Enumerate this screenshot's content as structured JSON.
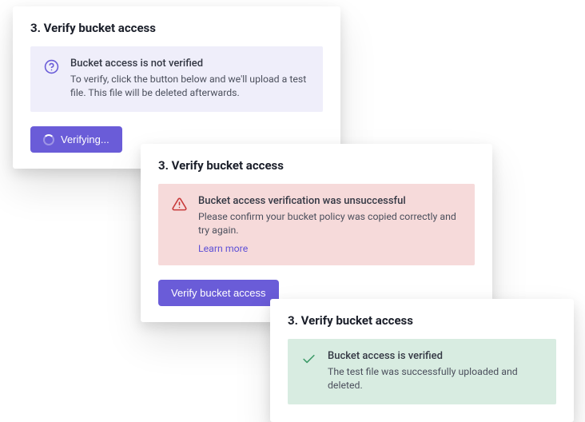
{
  "states": {
    "neutral": {
      "step_title": "3. Verify bucket access",
      "alert": {
        "title": "Bucket access is not verified",
        "description": "To verify, click the button below and we'll upload a test file. This file will be deleted afterwards.",
        "icon": "help-circle"
      },
      "button": {
        "label": "Verifying...",
        "loading": true
      }
    },
    "error": {
      "step_title": "3. Verify bucket access",
      "alert": {
        "title": "Bucket access verification was unsuccessful",
        "description": "Please confirm your bucket policy was copied correctly and try again.",
        "learn_more": "Learn more",
        "icon": "alert-triangle"
      },
      "button": {
        "label": "Verify bucket access",
        "loading": false
      }
    },
    "success": {
      "step_title": "3. Verify bucket access",
      "alert": {
        "title": "Bucket access is verified",
        "description": "The test file was successfully uploaded and deleted.",
        "icon": "check"
      }
    }
  },
  "colors": {
    "primary": "#6a5cd8",
    "neutral_bg": "#efeefa",
    "error_bg": "#f6dada",
    "success_bg": "#d8ece1",
    "error_icon": "#c83a3a",
    "success_icon": "#3d9a68"
  }
}
